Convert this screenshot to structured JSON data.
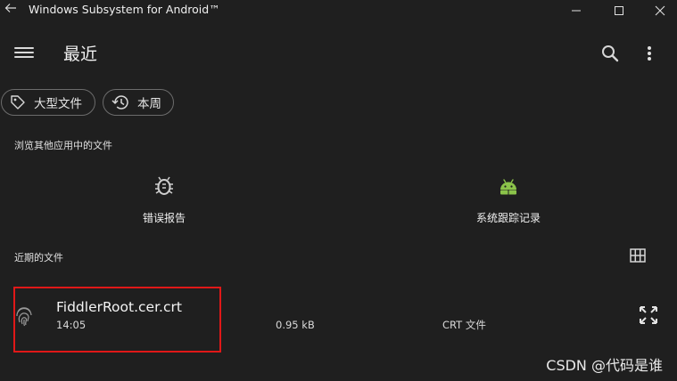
{
  "window": {
    "title": "Windows Subsystem for Android™"
  },
  "appbar": {
    "title": "最近"
  },
  "chips": [
    {
      "label": "大型文件",
      "icon": "tag-icon"
    },
    {
      "label": "本周",
      "icon": "history-icon"
    }
  ],
  "browse_section": {
    "heading": "浏览其他应用中的文件",
    "apps": [
      {
        "label": "错误报告",
        "icon": "bug-icon",
        "color": "#cfcfcf"
      },
      {
        "label": "系统跟踪记录",
        "icon": "android-icon",
        "color": "#8bc34a"
      }
    ]
  },
  "recent_section": {
    "heading": "近期的文件",
    "files": [
      {
        "name": "FiddlerRoot.cer.crt",
        "time": "14:05",
        "size": "0.95 kB",
        "type": "CRT 文件",
        "icon": "fingerprint-icon"
      }
    ]
  },
  "watermark": "CSDN @代码是谁",
  "colors": {
    "background": "#1f1f1f",
    "highlight_border": "#e01818",
    "android_green": "#8bc34a"
  }
}
